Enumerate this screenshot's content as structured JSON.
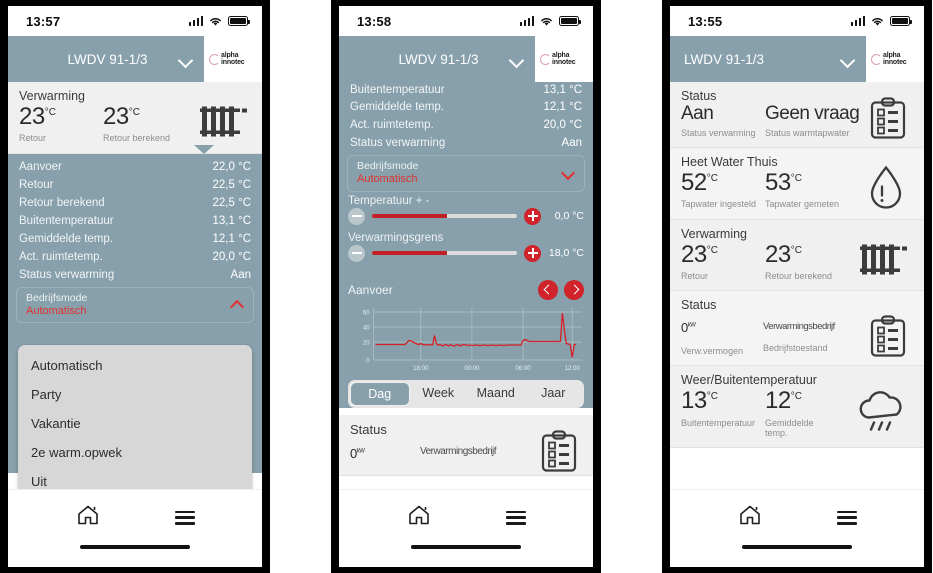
{
  "app": {
    "brand_line1": "alpha",
    "brand_line2": "innotec",
    "device_name": "LWDV 91-1/3"
  },
  "panels": [
    {
      "id": "panel-dropdown-open",
      "status_bar": {
        "time": "13:57"
      },
      "header": {
        "device": "LWDV 91-1/3"
      },
      "heating_card": {
        "title": "Verwarming",
        "metrics": [
          {
            "value": "23",
            "unit": "°C",
            "label": "Retour"
          },
          {
            "value": "23",
            "unit": "°C",
            "label": "Retour berekend"
          }
        ],
        "icon": "radiator-icon"
      },
      "data_rows": [
        {
          "label": "Aanvoer",
          "value": "22,0 °C"
        },
        {
          "label": "Retour",
          "value": "22,5 °C"
        },
        {
          "label": "Retour berekend",
          "value": "22,5 °C"
        },
        {
          "label": "Buitentemperatuur",
          "value": "13,1 °C"
        },
        {
          "label": "Gemiddelde temp.",
          "value": "12,1 °C"
        },
        {
          "label": "Act. ruimtetemp.",
          "value": "20,0 °C"
        },
        {
          "label": "Status verwarming",
          "value": "Aan"
        }
      ],
      "mode_select": {
        "label": "Bedrijfsmode",
        "value": "Automatisch",
        "expanded": true,
        "options": [
          "Automatisch",
          "Party",
          "Vakantie",
          "2e warm.opwek",
          "Uit"
        ]
      }
    },
    {
      "id": "panel-sliders-chart",
      "status_bar": {
        "time": "13:58"
      },
      "header": {
        "device": "LWDV 91-1/3"
      },
      "data_rows": [
        {
          "label": "Buitentemperatuur",
          "value": "13,1 °C"
        },
        {
          "label": "Gemiddelde temp.",
          "value": "12,1 °C"
        },
        {
          "label": "Act. ruimtetemp.",
          "value": "20,0 °C"
        },
        {
          "label": "Status verwarming",
          "value": "Aan"
        }
      ],
      "mode_select": {
        "label": "Bedrijfsmode",
        "value": "Automatisch",
        "expanded": false
      },
      "sliders": [
        {
          "label": "Temperatuur + -",
          "value": "0,0 °C",
          "fill_percent": 52
        },
        {
          "label": "Verwarmingsgrens",
          "value": "18,0 °C",
          "fill_percent": 52
        }
      ],
      "chart_card": {
        "title": "Aanvoer",
        "prev_label": "‹",
        "next_label": "›",
        "ranges": [
          "Dag",
          "Week",
          "Maand",
          "Jaar"
        ],
        "selected_range": "Dag"
      },
      "status_card": {
        "title": "Status",
        "metrics": [
          {
            "value": "0",
            "unit": "kW",
            "label": ""
          },
          {
            "value": "Verwarmingsbedrijf",
            "unit": "",
            "label": ""
          }
        ],
        "icon": "clipboard-icon"
      }
    },
    {
      "id": "panel-overview",
      "status_bar": {
        "time": "13:55"
      },
      "header": {
        "device": "LWDV 91-1/3"
      },
      "cards": [
        {
          "title": "Status",
          "icon": "clipboard-icon",
          "metrics": [
            {
              "value": "Aan",
              "unit": "",
              "label": "Status verwarming"
            },
            {
              "value": "Geen vraag",
              "unit": "",
              "label": "Status warmtapwater"
            }
          ]
        },
        {
          "title": "Heet Water Thuis",
          "icon": "water-drop-icon",
          "metrics": [
            {
              "value": "52",
              "unit": "°C",
              "label": "Tapwater ingesteld"
            },
            {
              "value": "53",
              "unit": "°C",
              "label": "Tapwater gemeten"
            }
          ]
        },
        {
          "title": "Verwarming",
          "icon": "radiator-icon",
          "metrics": [
            {
              "value": "23",
              "unit": "°C",
              "label": "Retour"
            },
            {
              "value": "23",
              "unit": "°C",
              "label": "Retour berekend"
            }
          ]
        },
        {
          "title": "Status",
          "icon": "clipboard-icon",
          "metrics": [
            {
              "value": "0",
              "unit": "kW",
              "label": "Verw.vermogen"
            },
            {
              "value": "Verwarmingsbedrijf",
              "unit": "",
              "label": "Bedrijfstoestand"
            }
          ]
        },
        {
          "title": "Weer/Buitentemperatuur",
          "icon": "cloud-rain-icon",
          "metrics": [
            {
              "value": "13",
              "unit": "°C",
              "label": "Buitentemperatuur"
            },
            {
              "value": "12",
              "unit": "°C",
              "label": "Gemiddelde temp."
            }
          ]
        }
      ]
    }
  ],
  "bottom_nav": {
    "home": "home-icon",
    "menu": "menu-icon"
  },
  "colors": {
    "accent_blue_grey": "#87a0ab",
    "accent_red": "#d0232b",
    "chart_line": "#d61f26",
    "card_bg": "#f0f0f0"
  },
  "chart_data": {
    "type": "line",
    "title": "Aanvoer",
    "xlabel": "",
    "ylabel": "",
    "ylim": [
      0,
      70
    ],
    "yticks": [
      0,
      20,
      40,
      60
    ],
    "xticks": [
      "18:00",
      "00:00",
      "06:00",
      "12:00"
    ],
    "grid": true,
    "legend": "none",
    "series": [
      {
        "name": "Aanvoer",
        "color": "#d61f26",
        "x": [
          0,
          2,
          4,
          6,
          8,
          10,
          12,
          13,
          14,
          15,
          16,
          17,
          18,
          19,
          20,
          21,
          22,
          23,
          24,
          25,
          26,
          27,
          28,
          29,
          30,
          31,
          32,
          33,
          34,
          35,
          36,
          37,
          38,
          39,
          40,
          41,
          42,
          43,
          44,
          45,
          46,
          47,
          48,
          50,
          52,
          54,
          56,
          58,
          60,
          62,
          64,
          66,
          68,
          70,
          72,
          74,
          75,
          76,
          77,
          78,
          79,
          80,
          82,
          84,
          86,
          88,
          90,
          92,
          94,
          95,
          96,
          97,
          98,
          99,
          100
        ],
        "y": [
          21,
          21,
          21,
          21,
          21,
          21,
          21,
          26,
          25,
          24,
          23,
          22,
          21,
          22,
          21,
          20,
          21,
          20,
          21,
          20,
          21,
          30,
          22,
          20,
          21,
          19,
          20,
          21,
          19,
          21,
          20,
          19,
          20,
          21,
          19,
          20,
          21,
          19,
          20,
          21,
          20,
          20,
          20,
          20,
          20,
          20,
          20,
          20,
          20,
          20,
          20,
          20,
          20,
          20,
          20,
          26,
          27,
          26,
          25,
          25,
          25,
          25,
          25,
          25,
          25,
          25,
          25,
          25,
          62,
          40,
          22,
          21,
          21,
          6,
          21
        ]
      }
    ]
  }
}
